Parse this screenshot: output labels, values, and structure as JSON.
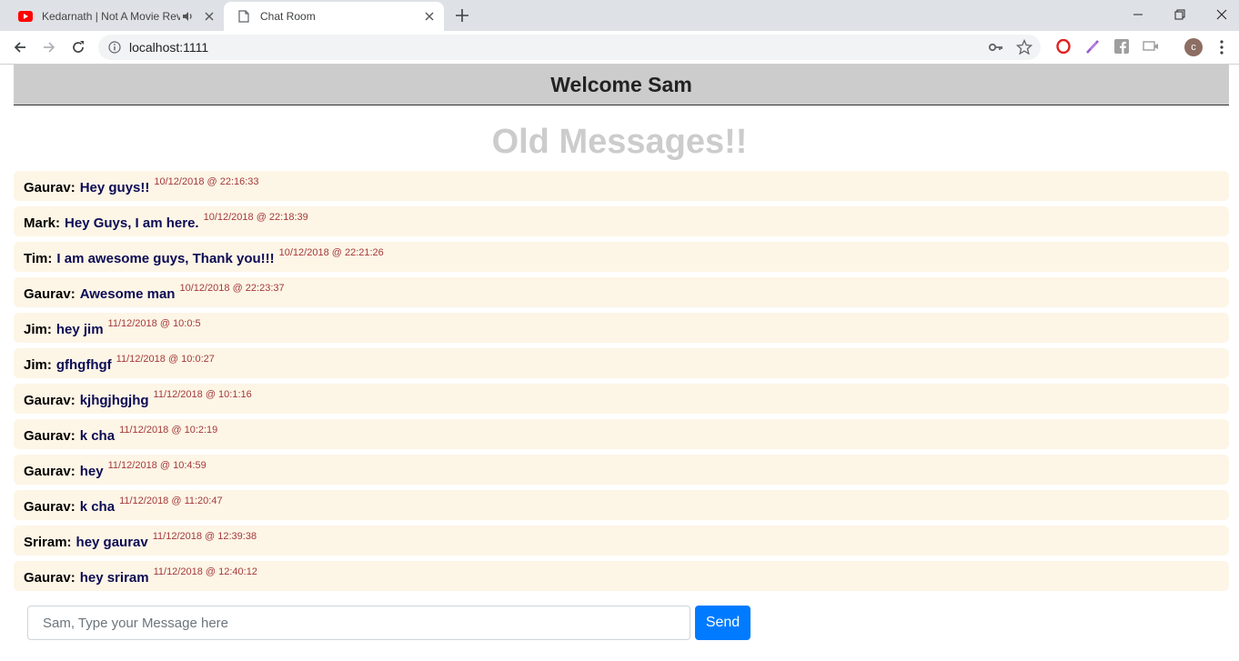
{
  "browser": {
    "tabs": [
      {
        "title": "Kedarnath | Not A Movie Rev",
        "active": false,
        "favicon": "youtube-icon",
        "audio": true
      },
      {
        "title": "Chat Room",
        "active": true,
        "favicon": "page-icon"
      }
    ],
    "url": "localhost:1111",
    "profile_initial": "c"
  },
  "page": {
    "welcome": "Welcome Sam",
    "old_messages_title": "Old Messages!!",
    "messages": [
      {
        "user": "Gaurav:",
        "text": "Hey guys!!",
        "timestamp": "10/12/2018 @ 22:16:33"
      },
      {
        "user": "Mark:",
        "text": "Hey Guys, I am here.",
        "timestamp": "10/12/2018 @ 22:18:39"
      },
      {
        "user": "Tim:",
        "text": "I am awesome guys, Thank you!!!",
        "timestamp": "10/12/2018 @ 22:21:26"
      },
      {
        "user": "Gaurav:",
        "text": "Awesome man",
        "timestamp": "10/12/2018 @ 22:23:37"
      },
      {
        "user": "Jim:",
        "text": "hey jim",
        "timestamp": "11/12/2018 @ 10:0:5"
      },
      {
        "user": "Jim:",
        "text": "gfhgfhgf",
        "timestamp": "11/12/2018 @ 10:0:27"
      },
      {
        "user": "Gaurav:",
        "text": "kjhgjhgjhg",
        "timestamp": "11/12/2018 @ 10:1:16"
      },
      {
        "user": "Gaurav:",
        "text": "k cha",
        "timestamp": "11/12/2018 @ 10:2:19"
      },
      {
        "user": "Gaurav:",
        "text": "hey",
        "timestamp": "11/12/2018 @ 10:4:59"
      },
      {
        "user": "Gaurav:",
        "text": "k cha",
        "timestamp": "11/12/2018 @ 11:20:47"
      },
      {
        "user": "Sriram:",
        "text": "hey gaurav",
        "timestamp": "11/12/2018 @ 12:39:38"
      },
      {
        "user": "Gaurav:",
        "text": "hey sriram",
        "timestamp": "11/12/2018 @ 12:40:12"
      }
    ],
    "input_placeholder": "Sam, Type your Message here",
    "input_value": "",
    "send_label": "Send"
  },
  "colors": {
    "header_bg": "#cccccc",
    "message_bg": "#fdf5e6",
    "message_text": "#0b0b55",
    "timestamp": "#a33a3a",
    "send_button": "#007bff"
  }
}
